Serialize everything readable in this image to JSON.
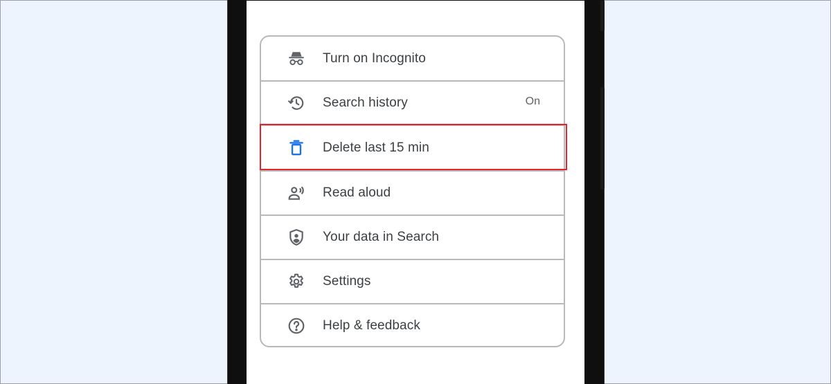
{
  "menu": {
    "items": [
      {
        "id": "incognito",
        "icon": "incognito-icon",
        "label": "Turn on Incognito",
        "status": ""
      },
      {
        "id": "search-history",
        "icon": "history-icon",
        "label": "Search history",
        "status": "On"
      },
      {
        "id": "delete-15",
        "icon": "trash-icon",
        "label": "Delete last 15 min",
        "status": ""
      },
      {
        "id": "read-aloud",
        "icon": "read-aloud-icon",
        "label": "Read aloud",
        "status": ""
      },
      {
        "id": "your-data",
        "icon": "shield-person-icon",
        "label": "Your data in Search",
        "status": ""
      },
      {
        "id": "settings",
        "icon": "gear-icon",
        "label": "Settings",
        "status": ""
      },
      {
        "id": "help",
        "icon": "help-icon",
        "label": "Help & feedback",
        "status": ""
      }
    ]
  },
  "colors": {
    "accent_blue": "#1a73e8",
    "highlight_red": "#e3242b",
    "icon_gray": "#5f6368",
    "text": "#3c4043",
    "background": "#eef4fd"
  }
}
